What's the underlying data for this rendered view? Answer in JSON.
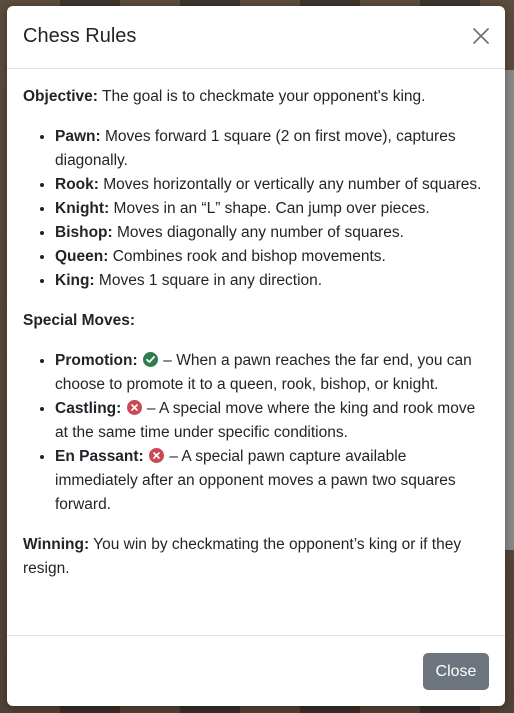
{
  "modal": {
    "title": "Chess Rules",
    "close_button_label": "Close"
  },
  "objective": {
    "label": "Objective:",
    "text": " The goal is to checkmate your opponent's king."
  },
  "pieces": [
    {
      "name": "Pawn:",
      "text": " Moves forward 1 square (2 on first move), captures diagonally."
    },
    {
      "name": "Rook:",
      "text": " Moves horizontally or vertically any number of squares."
    },
    {
      "name": "Knight:",
      "text": " Moves in an “L” shape. Can jump over pieces."
    },
    {
      "name": "Bishop:",
      "text": " Moves diagonally any number of squares."
    },
    {
      "name": "Queen:",
      "text": " Combines rook and bishop movements."
    },
    {
      "name": "King:",
      "text": " Moves 1 square in any direction."
    }
  ],
  "special_moves": {
    "heading": "Special Moves:",
    "items": [
      {
        "name": "Promotion:",
        "status_icon": "check-circle-icon",
        "status_color": "#2e7d4f",
        "text": " – When a pawn reaches the far end, you can choose to promote it to a queen, rook, bishop, or knight."
      },
      {
        "name": "Castling:",
        "status_icon": "x-circle-icon",
        "status_color": "#c94a52",
        "text": " – A special move where the king and rook move at the same time under specific conditions."
      },
      {
        "name": "En Passant:",
        "status_icon": "x-circle-icon",
        "status_color": "#c94a52",
        "text": " – A special pawn capture available immediately after an opponent moves a pawn two squares forward."
      }
    ]
  },
  "winning": {
    "label": "Winning:",
    "text": " You win by checkmating the opponent’s king or if they resign."
  }
}
